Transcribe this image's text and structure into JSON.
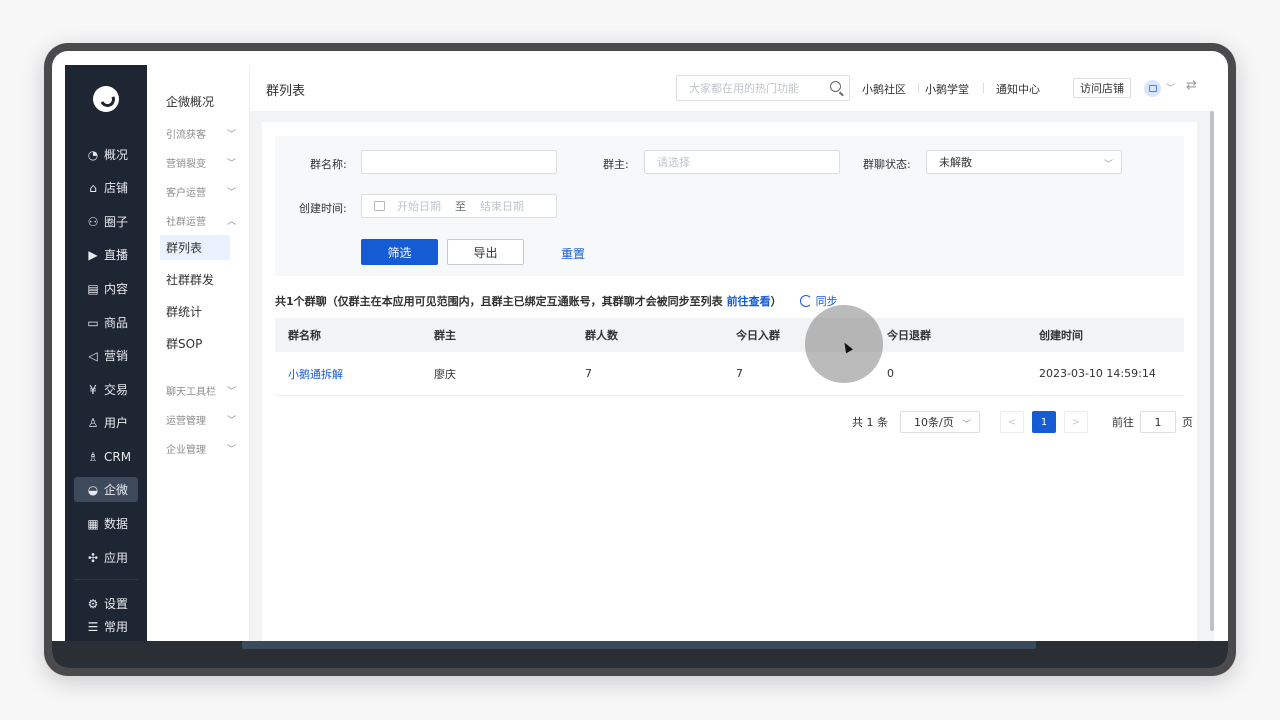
{
  "nav1": {
    "items": [
      {
        "label": "概况",
        "icon": "◔"
      },
      {
        "label": "店铺",
        "icon": "⌂"
      },
      {
        "label": "圈子",
        "icon": "⚇"
      },
      {
        "label": "直播",
        "icon": "▶"
      },
      {
        "label": "内容",
        "icon": "▤"
      },
      {
        "label": "商品",
        "icon": "▭"
      },
      {
        "label": "营销",
        "icon": "◁"
      },
      {
        "label": "交易",
        "icon": "¥"
      },
      {
        "label": "用户",
        "icon": "♙"
      },
      {
        "label": "CRM",
        "icon": "♗"
      },
      {
        "label": "企微",
        "icon": "◒"
      },
      {
        "label": "数据",
        "icon": "▦"
      },
      {
        "label": "应用",
        "icon": "✣"
      },
      {
        "label": "设置",
        "icon": "⚙"
      },
      {
        "label": "常用",
        "icon": "☰"
      }
    ]
  },
  "nav2": {
    "title": "企微概况",
    "groups": [
      "引流获客",
      "营销裂变",
      "客户运营",
      "社群运营",
      "聊天工具栏",
      "运营管理",
      "企业管理"
    ],
    "items": [
      "群列表",
      "社群群发",
      "群统计",
      "群SOP"
    ]
  },
  "topbar": {
    "title": "群列表",
    "search_placeholder": "大家都在用的热门功能",
    "links": [
      "小鹅社区",
      "小鹅学堂",
      "通知中心"
    ],
    "visit_store": "访问店铺"
  },
  "filter": {
    "group_name_label": "群名称:",
    "owner_label": "群主:",
    "owner_placeholder": "请选择",
    "status_label": "群聊状态:",
    "status_value": "未解散",
    "created_label": "创建时间:",
    "start_placeholder": "开始日期",
    "date_sep": "至",
    "end_placeholder": "结束日期",
    "filter_btn": "筛选",
    "export_btn": "导出",
    "reset_btn": "重置"
  },
  "summary": {
    "text": "共1个群聊（仅群主在本应用可见范围内，且群主已绑定互通账号，其群聊才会被同步至列表",
    "link": "前往查看",
    "close": "）",
    "sync": "同步"
  },
  "table": {
    "headers": [
      "群名称",
      "群主",
      "群人数",
      "今日入群",
      "今日退群",
      "创建时间"
    ],
    "rows": [
      [
        "小鹅通拆解",
        "廖庆",
        "7",
        "7",
        "0",
        "2023-03-10 14:59:14"
      ]
    ]
  },
  "pager": {
    "total": "共 1 条",
    "page_size": "10条/页",
    "current": "1",
    "goto_label": "前往",
    "goto_value": "1",
    "page_suffix": "页"
  },
  "colors": {
    "primary": "#155bd4",
    "nav_bg": "#1e2634"
  }
}
